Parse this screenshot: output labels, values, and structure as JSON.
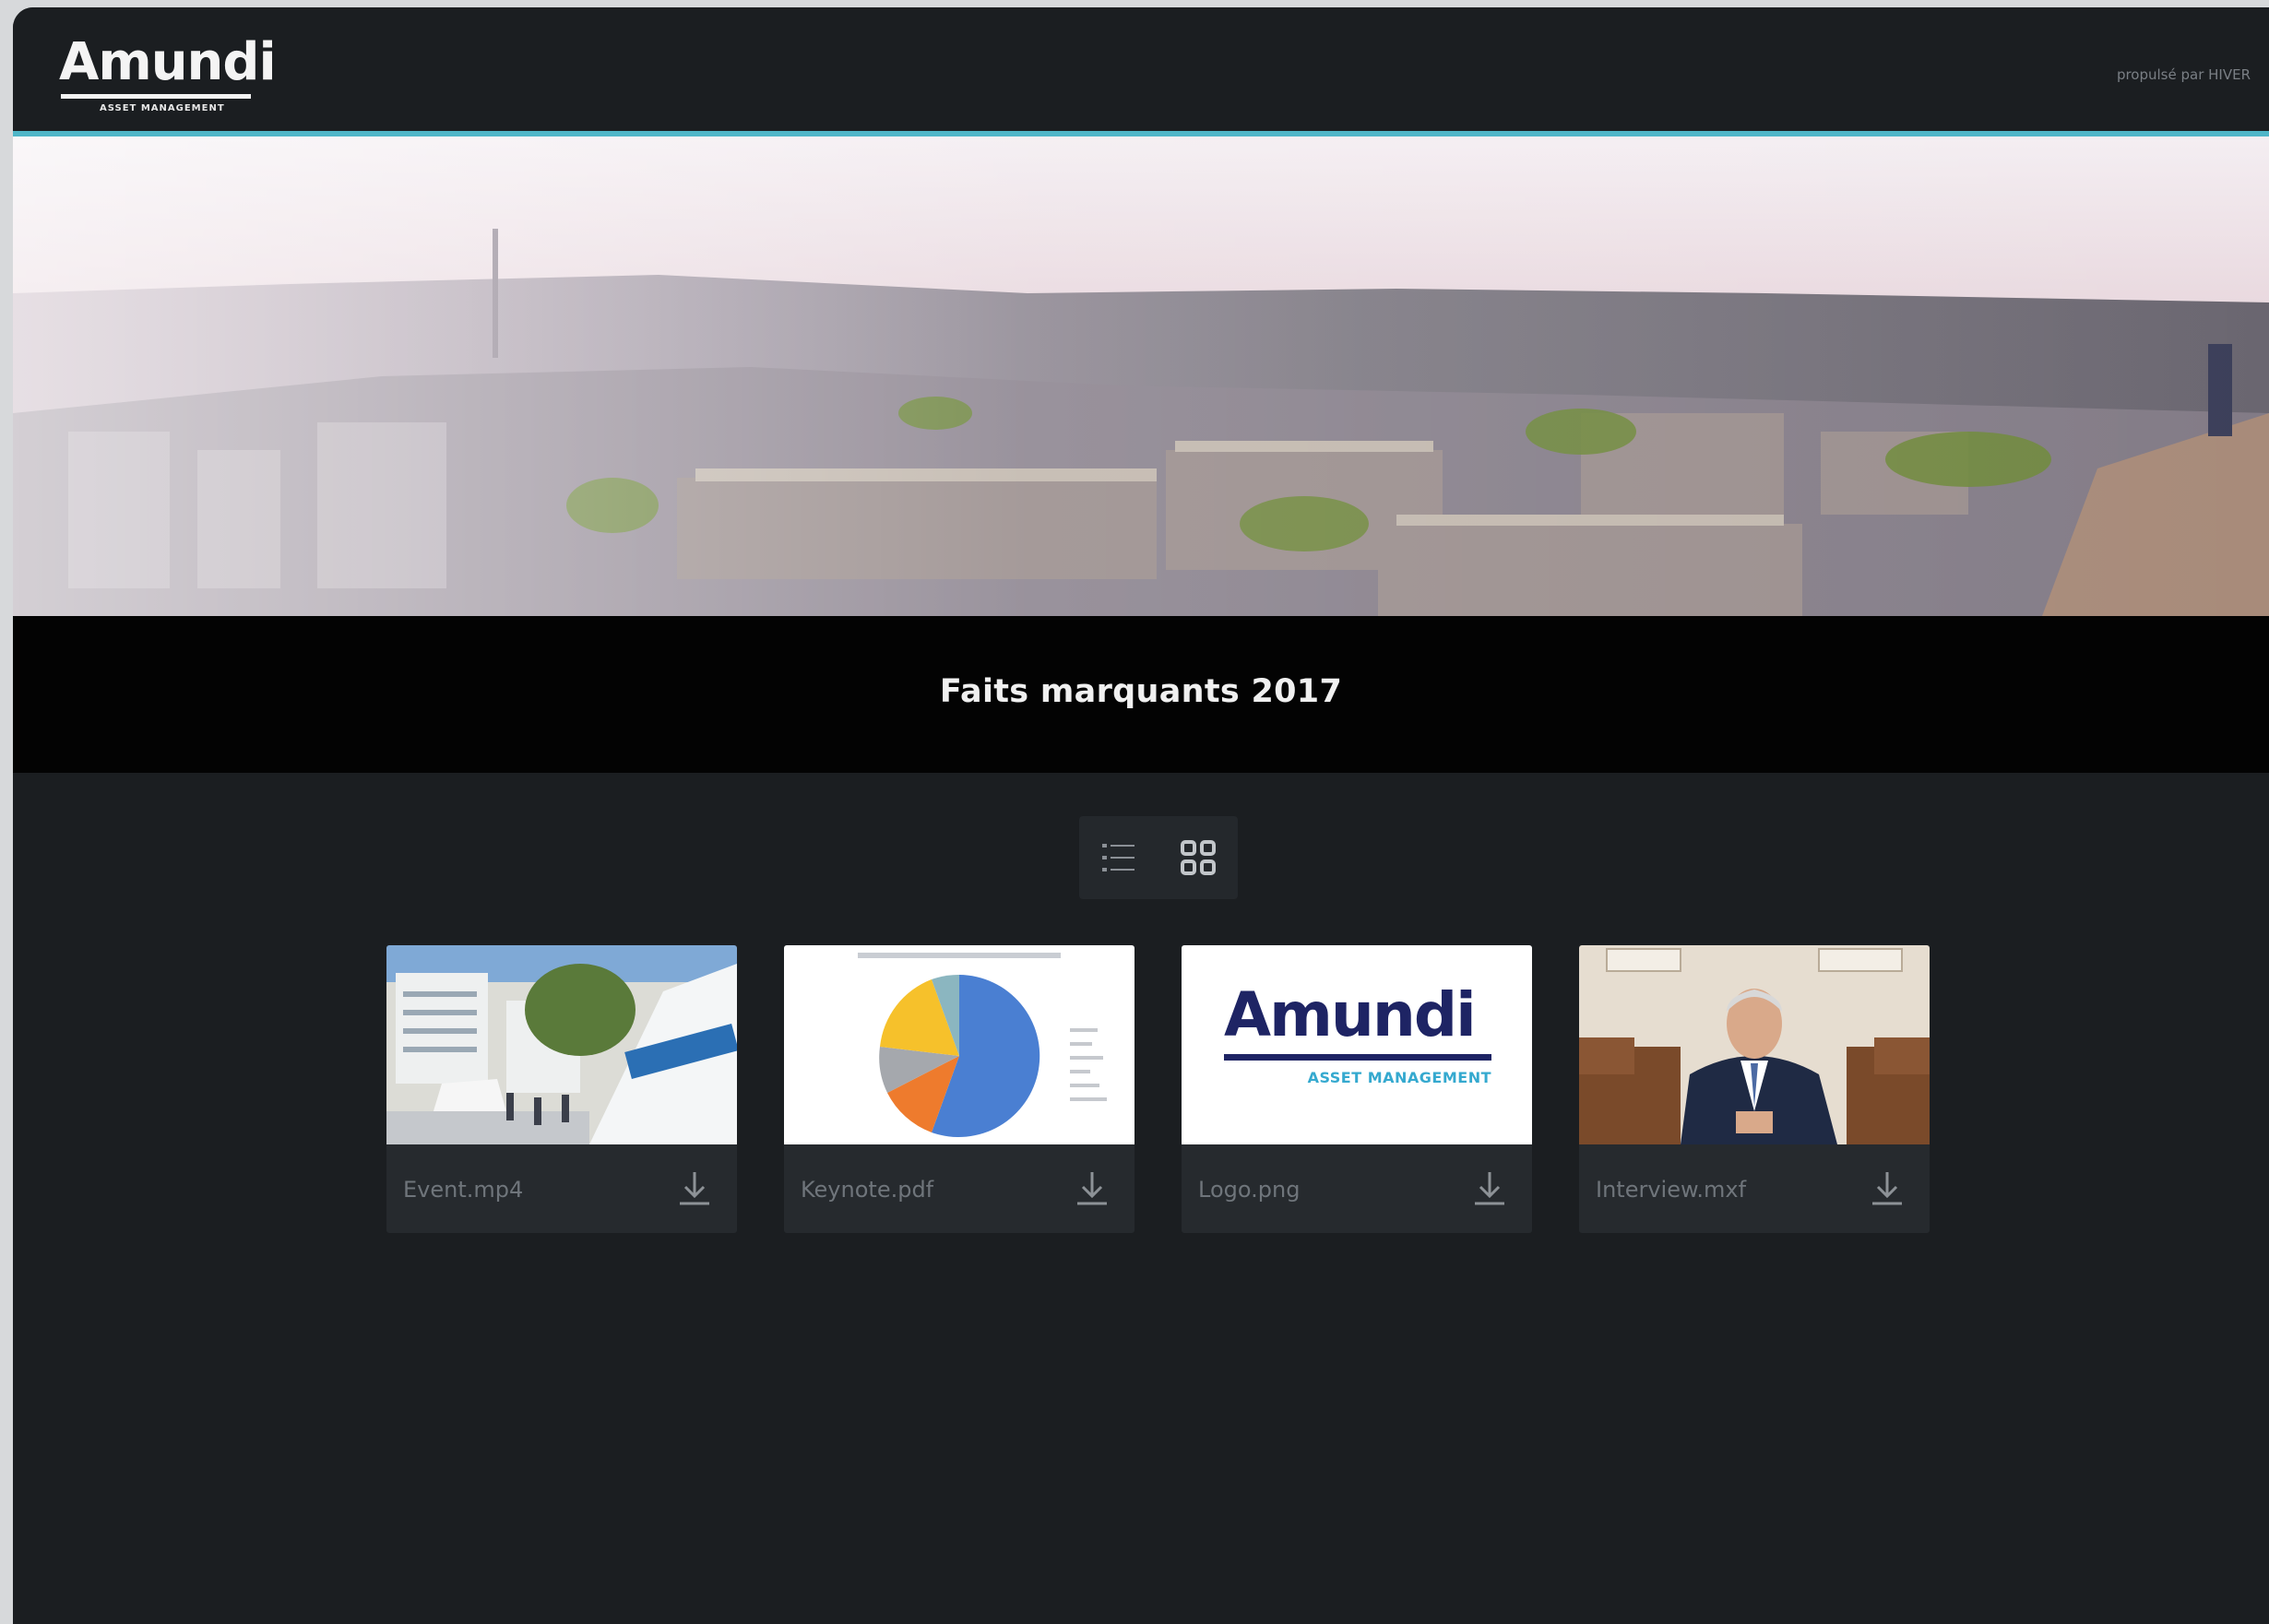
{
  "header": {
    "logo_word": "Amundi",
    "logo_sub": "ASSET MANAGEMENT",
    "powered_by": "propulsé par HIVER"
  },
  "page": {
    "title": "Faits marquants 2017"
  },
  "view_toggle": {
    "selected": "grid"
  },
  "files": [
    {
      "name": "Event.mp4",
      "thumbnail": "event-photo"
    },
    {
      "name": "Keynote.pdf",
      "thumbnail": "pie-chart-slide"
    },
    {
      "name": "Logo.png",
      "thumbnail": "amundi-logo",
      "logo_word": "Amundi",
      "logo_sub": "ASSET MANAGEMENT"
    },
    {
      "name": "Interview.mxf",
      "thumbnail": "interview-photo"
    }
  ],
  "colors": {
    "accent": "#4fb6c8",
    "background": "#1b1e21",
    "card": "#262a2e",
    "logo_navy": "#1e2464",
    "logo_cyan": "#35a9cf"
  }
}
